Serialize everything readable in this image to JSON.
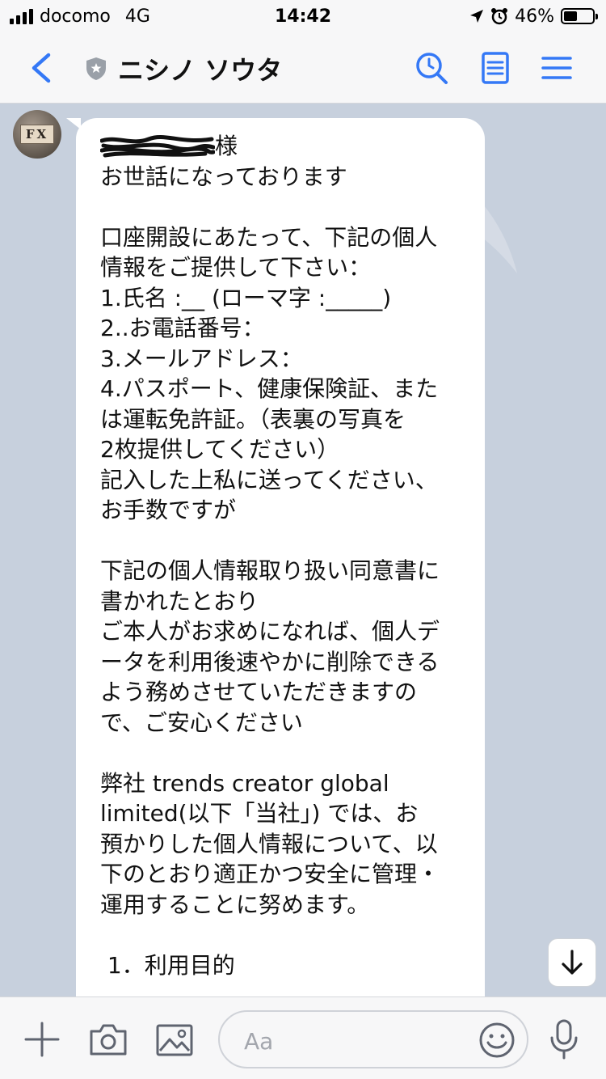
{
  "status_bar": {
    "carrier": "docomo",
    "network": "4G",
    "time": "14:42",
    "battery": "46%",
    "battery_level": 0.46
  },
  "header": {
    "title": "ニシノ ソウタ"
  },
  "message": {
    "lines": [
      "様",
      "お世話になっております",
      "",
      "口座開設にあたって、下記の個人",
      "情報をご提供して下さい：",
      "1.氏名 :__ (ローマ字 :_____)",
      "2..お電話番号：",
      "3.メールアドレス：",
      "4.パスポート、健康保険証、また",
      "は運転免許証。（表裏の写真を",
      "2枚提供してください）",
      "記入した上私に送ってください、",
      "お手数ですが",
      "",
      "下記の個人情報取り扱い同意書に",
      "書かれたとおり",
      "ご本人がお求めになれば、個人デ",
      "ータを利用後速やかに削除できる",
      "よう務めさせていただきますの",
      "で、ご安心ください",
      "",
      "弊社 trends creator global",
      "limited(以下「当社」) では、お",
      "預かりした個人情報について、以",
      "下のとおり適正かつ安全に管理・",
      "運用することに努めます。",
      "",
      " 1．利用目的"
    ]
  },
  "avatar": {
    "label": "FX"
  },
  "composer": {
    "placeholder": "Aa"
  },
  "colors": {
    "accent": "#3478f6",
    "chat_background": "#c7d0dd",
    "bubble": "#ffffff",
    "icon_gray": "#5f6470"
  },
  "icons": {
    "back": "chevron-left-icon",
    "verified": "shield-icon",
    "search": "search-icon",
    "notes": "notes-icon",
    "menu": "menu-icon",
    "scroll": "arrow-down-icon",
    "add": "plus-icon",
    "camera": "camera-icon",
    "image": "image-icon",
    "emoji": "emoji-icon",
    "mic": "microphone-icon"
  }
}
